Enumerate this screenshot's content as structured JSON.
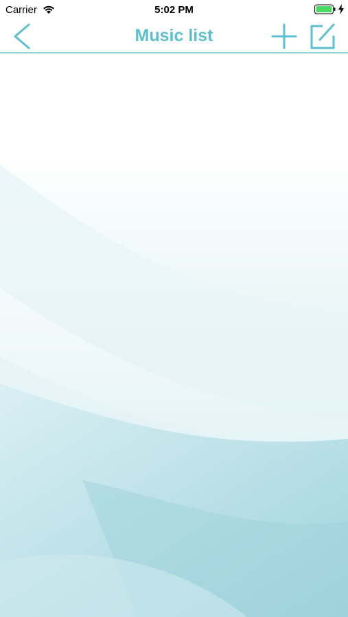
{
  "status_bar": {
    "carrier": "Carrier",
    "time": "5:02 PM",
    "wifi_icon": "wifi-icon",
    "battery_icon": "battery-icon",
    "charging_icon": "charging-bolt-icon",
    "battery_level": 1.0,
    "battery_color": "#4cd964"
  },
  "nav_bar": {
    "title": "Music list",
    "back_icon": "chevron-left-icon",
    "add_icon": "plus-icon",
    "edit_icon": "edit-icon",
    "accent_color": "#5cbfd0"
  },
  "content": {
    "items": []
  }
}
